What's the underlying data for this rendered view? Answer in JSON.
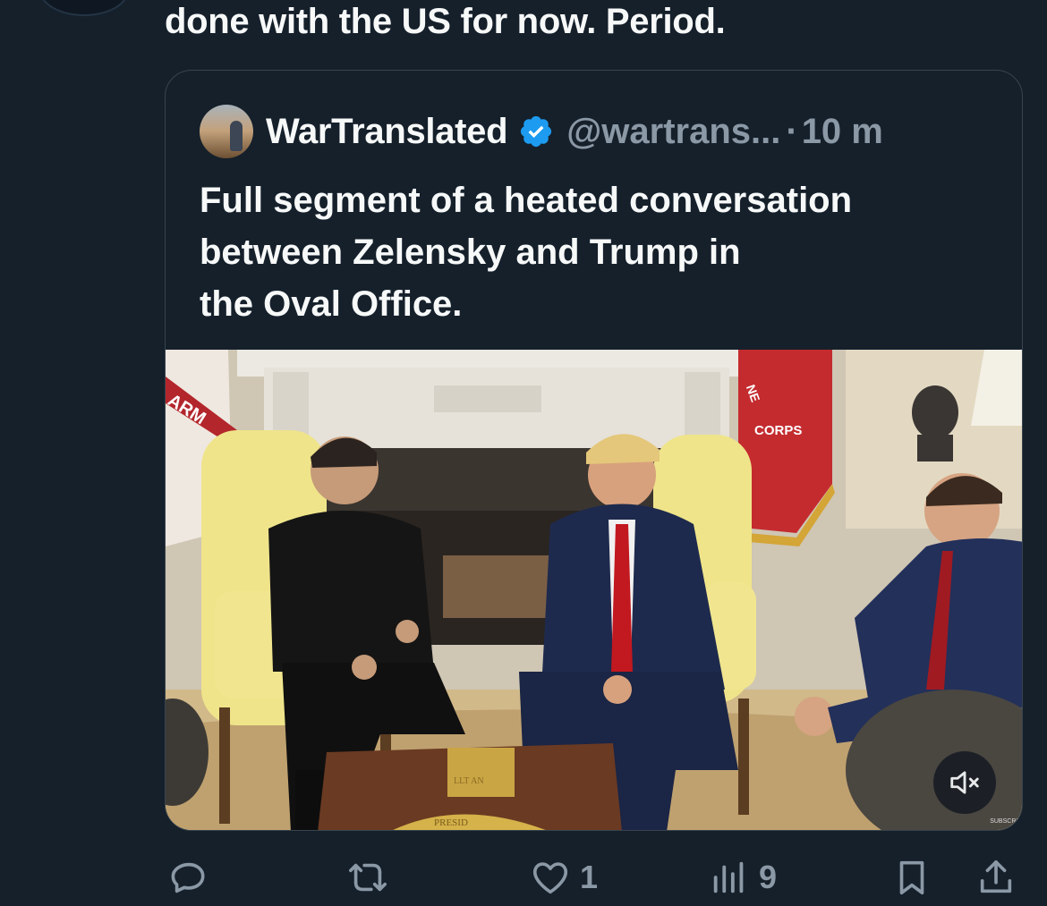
{
  "tweet": {
    "text_tail": "done with the US for now. Period."
  },
  "quote": {
    "display_name": "WarTranslated",
    "handle": "@wartrans...",
    "separator": "·",
    "time": "10 m",
    "text_lines": [
      "Full segment of a heated conversation",
      "between Zelensky and Trump in",
      "the Oval Office."
    ],
    "media": {
      "type": "video",
      "muted": true,
      "flag_text_left": "ARM",
      "flag_text_right": "CORPS",
      "flag_text_right_top": "NE",
      "desk_text": "PRESID",
      "corner_mark": "SUBSCRIB"
    }
  },
  "actions": {
    "reply_count": "",
    "retweet_count": "",
    "like_count": "1",
    "views_count": "9"
  },
  "colors": {
    "background": "#15202b",
    "text_primary": "#f7f9f9",
    "text_secondary": "#8b98a5",
    "border": "#38444d",
    "verified_blue": "#1d9bf0"
  }
}
